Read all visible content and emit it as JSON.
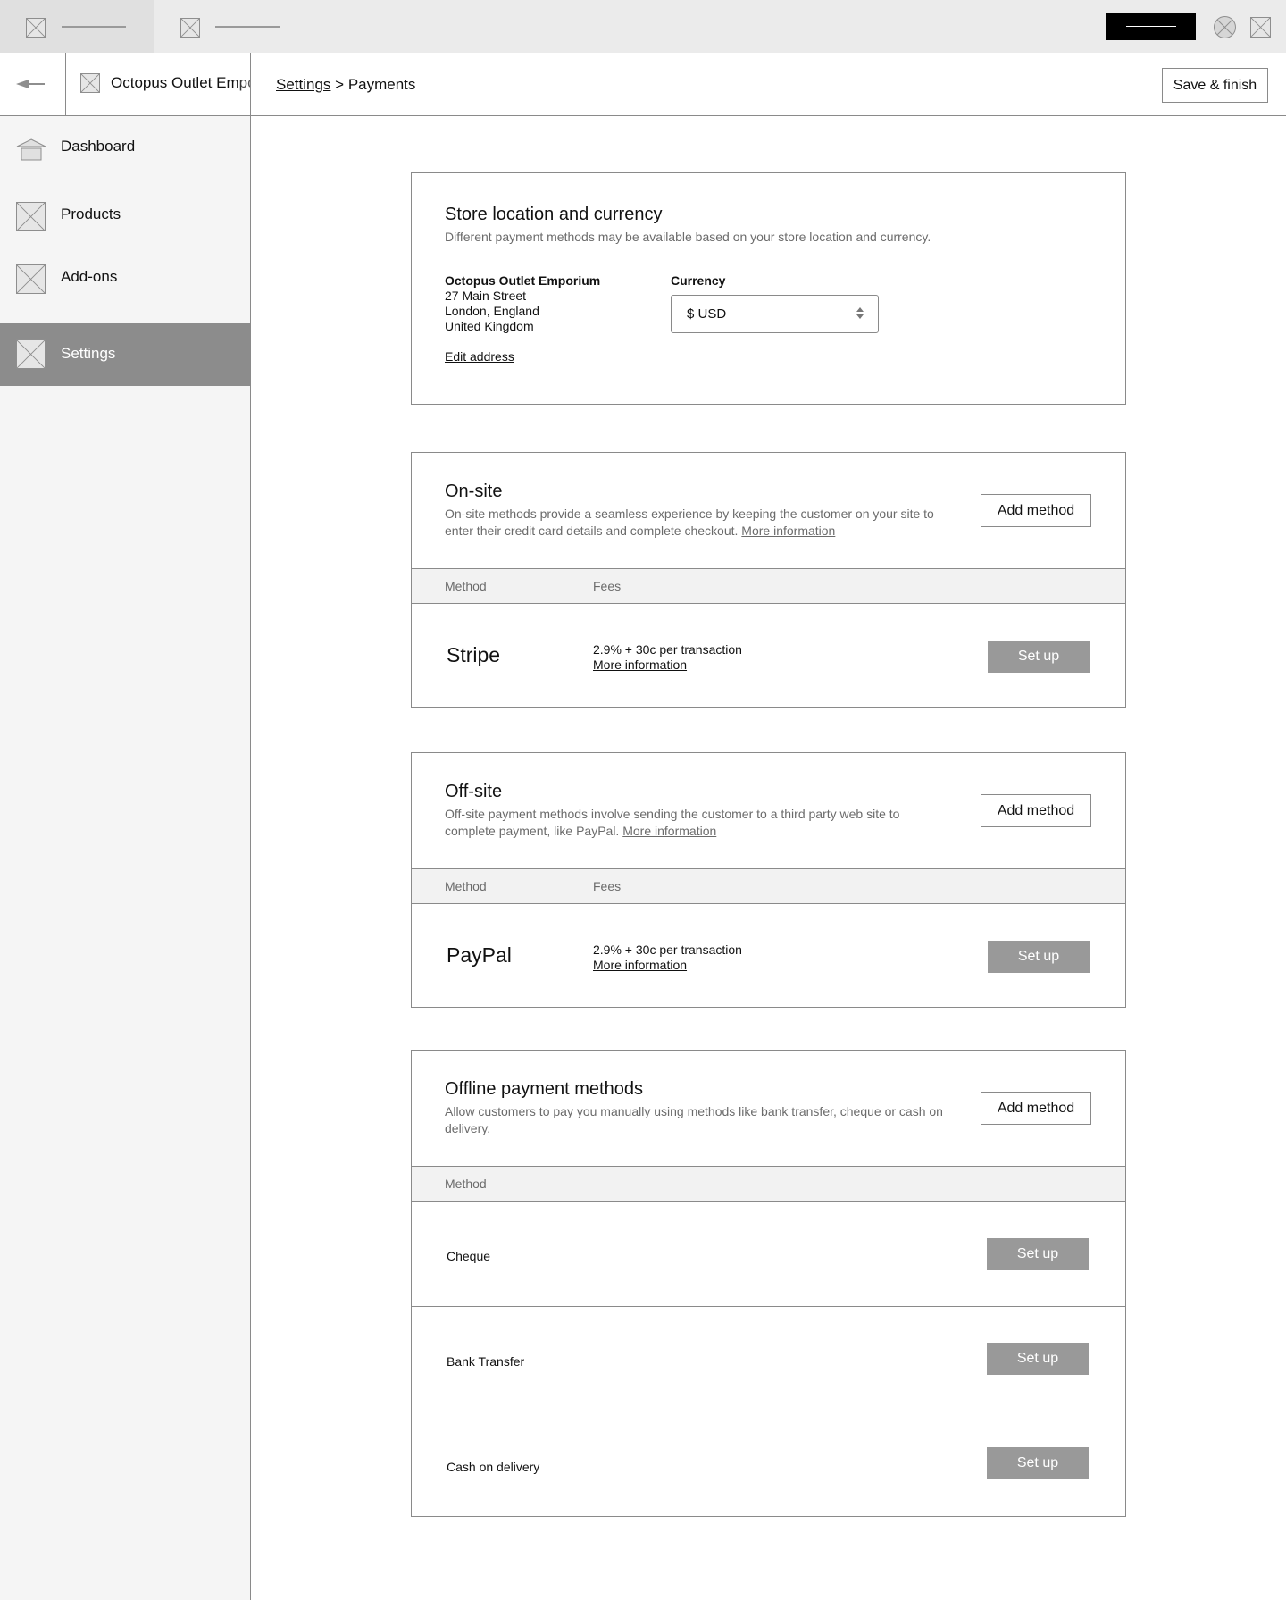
{
  "header": {
    "store_name": "Octopus Outlet Emporium",
    "breadcrumb_parent": "Settings",
    "breadcrumb_separator": " > ",
    "breadcrumb_current": "Payments",
    "save_label": "Save & finish"
  },
  "sidebar": {
    "items": [
      {
        "label": "Dashboard",
        "icon": "home-icon"
      },
      {
        "label": "Products",
        "icon": "placeholder-image-icon"
      },
      {
        "label": "Add-ons",
        "icon": "placeholder-image-icon"
      },
      {
        "label": "Settings",
        "icon": "placeholder-image-icon",
        "active": true
      }
    ]
  },
  "store_location": {
    "title": "Store location and currency",
    "description": "Different payment methods may be available based on your store location and currency.",
    "address_name": "Octopus Outlet Emporium",
    "address_line1": "27 Main Street",
    "address_line2": "London, England",
    "address_line3": "United Kingdom",
    "edit_label": "Edit address",
    "currency_label": "Currency",
    "currency_value": "$ USD"
  },
  "onsite": {
    "title": "On-site",
    "description": "On-site methods provide a seamless experience by keeping the customer on your site to enter their credit card details and complete checkout. ",
    "more_info": "More information",
    "add_label": "Add method",
    "col_method": "Method",
    "col_fees": "Fees",
    "method_name": "Stripe",
    "fee": "2.9% + 30c per transaction",
    "fee_link": "More information",
    "setup_label": "Set up"
  },
  "offsite": {
    "title": "Off-site",
    "description": "Off-site payment methods involve sending the customer to a third party web site to complete payment, like PayPal. ",
    "more_info": "More information",
    "add_label": "Add method",
    "col_method": "Method",
    "col_fees": "Fees",
    "method_name": "PayPal",
    "fee": "2.9% + 30c per transaction",
    "fee_link": "More information",
    "setup_label": "Set up"
  },
  "offline": {
    "title": "Offline payment methods",
    "description": "Allow customers to pay you manually using methods like bank transfer, cheque or cash on delivery.",
    "add_label": "Add method",
    "col_method": "Method",
    "methods": [
      {
        "name": "Cheque",
        "setup_label": "Set up"
      },
      {
        "name": "Bank Transfer",
        "setup_label": "Set up"
      },
      {
        "name": "Cash on delivery",
        "setup_label": "Set up"
      }
    ]
  },
  "colors": {
    "sidebar_active": "#8c8c8c",
    "button_gray": "#999999",
    "topbar": "#ebebeb"
  }
}
